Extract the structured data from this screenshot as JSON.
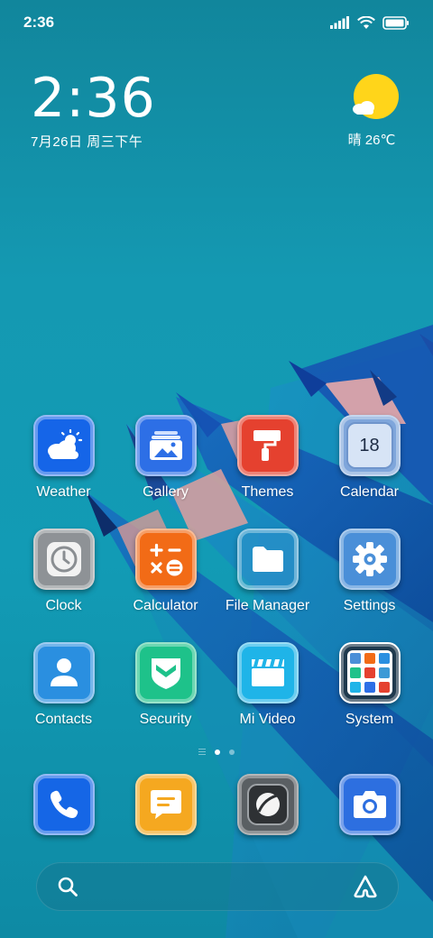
{
  "status_bar": {
    "time": "2:36",
    "icons": [
      "signal-icon",
      "wifi-icon",
      "battery-icon"
    ]
  },
  "clock_widget": {
    "time": "2:36",
    "date": "7月26日 周三下午"
  },
  "weather_widget": {
    "condition_icon": "sun-cloud-icon",
    "text": "晴 26℃"
  },
  "apps": [
    {
      "label": "Weather",
      "icon": "weather-icon",
      "color": "#1565e8"
    },
    {
      "label": "Gallery",
      "icon": "gallery-icon",
      "color": "#2d6fe6"
    },
    {
      "label": "Themes",
      "icon": "themes-icon",
      "color": "#e5412f"
    },
    {
      "label": "Calendar",
      "icon": "calendar-icon",
      "color": "#7fa6db",
      "badge": "18"
    },
    {
      "label": "Clock",
      "icon": "clock-icon",
      "color": "#8e9296"
    },
    {
      "label": "Calculator",
      "icon": "calculator-icon",
      "color": "#f26b16"
    },
    {
      "label": "File Manager",
      "icon": "folder-icon",
      "color": "#3d9ad6"
    },
    {
      "label": "Settings",
      "icon": "gear-icon",
      "color": "#4a8fd8"
    },
    {
      "label": "Contacts",
      "icon": "contacts-icon",
      "color": "#2a8fe0"
    },
    {
      "label": "Security",
      "icon": "shield-icon",
      "color": "#1ec28a"
    },
    {
      "label": "Mi Video",
      "icon": "video-icon",
      "color": "#1fb4e8"
    },
    {
      "label": "System",
      "icon": "system-folder-icon",
      "color": "#1f3a4e"
    }
  ],
  "page_indicator": {
    "pages": 2,
    "active": 1
  },
  "dock": [
    {
      "name": "Phone",
      "icon": "phone-icon",
      "color": "#1566e6"
    },
    {
      "name": "Messages",
      "icon": "message-icon",
      "color": "#f5a820"
    },
    {
      "name": "Browser",
      "icon": "browser-icon",
      "color": "#5a5f63"
    },
    {
      "name": "Camera",
      "icon": "camera-icon",
      "color": "#2d6fe0"
    }
  ],
  "search_bar": {
    "left_icon": "search-icon",
    "right_icon": "assistant-icon"
  }
}
